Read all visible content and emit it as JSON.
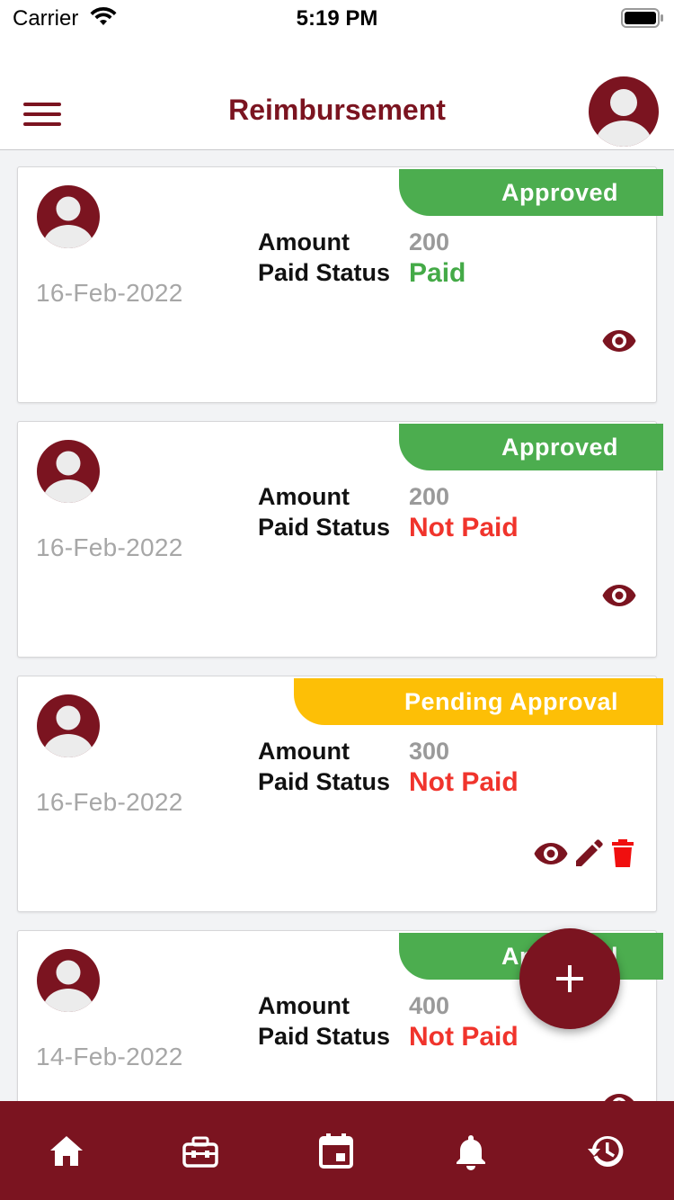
{
  "status_bar": {
    "carrier": "Carrier",
    "time": "5:19 PM"
  },
  "header": {
    "title": "Reimbursement"
  },
  "labels": {
    "amount": "Amount",
    "paid_status": "Paid Status"
  },
  "cards": [
    {
      "status": "Approved",
      "status_type": "approved",
      "date": "16-Feb-2022",
      "amount": "200",
      "paid_status": "Paid",
      "actions": [
        "view"
      ]
    },
    {
      "status": "Approved",
      "status_type": "approved",
      "date": "16-Feb-2022",
      "amount": "200",
      "paid_status": "Not Paid",
      "actions": [
        "view"
      ]
    },
    {
      "status": "Pending Approval",
      "status_type": "pending",
      "date": "16-Feb-2022",
      "amount": "300",
      "paid_status": "Not Paid",
      "actions": [
        "view",
        "edit",
        "delete"
      ]
    },
    {
      "status": "Approved",
      "status_type": "approved",
      "date": "14-Feb-2022",
      "amount": "400",
      "paid_status": "Not Paid",
      "actions": [
        "view"
      ]
    }
  ],
  "colors": {
    "brand": "#7b1420",
    "approved": "#4cad4f",
    "pending": "#fdbf06",
    "paid": "#44aa47",
    "not_paid": "#f0342c"
  },
  "tabs": [
    {
      "icon": "home-icon"
    },
    {
      "icon": "toolbox-icon"
    },
    {
      "icon": "calendar-icon"
    },
    {
      "icon": "bell-icon"
    },
    {
      "icon": "history-icon"
    }
  ]
}
